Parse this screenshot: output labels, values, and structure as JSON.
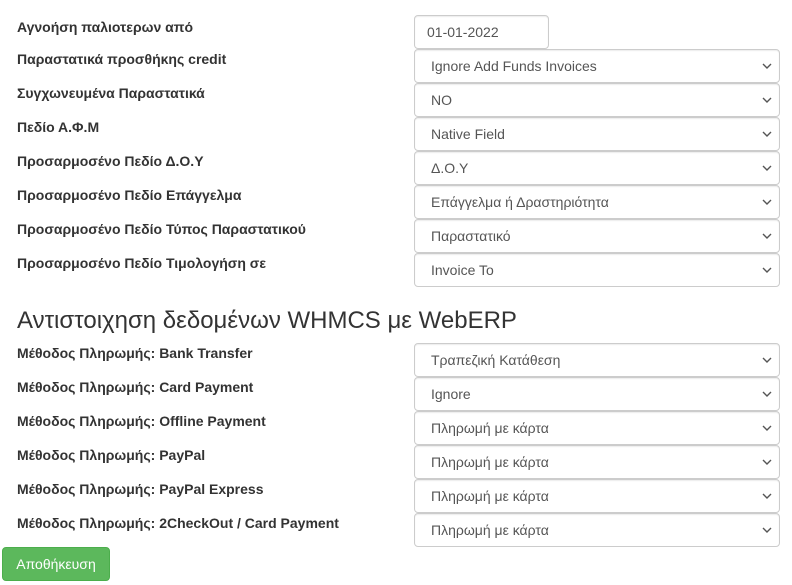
{
  "settings": [
    {
      "label": "Αγνοήση παλιοτερων από",
      "type": "date",
      "value": "01-01-2022"
    },
    {
      "label": "Παραστατικά προσθήκης credit",
      "type": "select",
      "value": "Ignore Add Funds Invoices"
    },
    {
      "label": "Συγχωνευμένα Παραστατικά",
      "type": "select",
      "value": "NO"
    },
    {
      "label": "Πεδίο Α.Φ.Μ",
      "type": "select",
      "value": "Native Field"
    },
    {
      "label": "Προσαρμοσένο Πεδίο Δ.Ο.Υ",
      "type": "select",
      "value": "Δ.Ο.Υ"
    },
    {
      "label": "Προσαρμοσένο Πεδίο Επάγγελμα",
      "type": "select",
      "value": "Επάγγελμα ή Δραστηριότητα"
    },
    {
      "label": "Προσαρμοσένο Πεδίο Τύπος Παραστατικού",
      "type": "select",
      "value": "Παραστατικό"
    },
    {
      "label": "Προσαρμοσένο Πεδίο Τιμολογήση σε",
      "type": "select",
      "value": "Invoice To"
    }
  ],
  "mapping_heading": "Αντιστοιχηση δεδομένων WHMCS με WebERP",
  "payment_methods": [
    {
      "label": "Μέθοδος Πληρωμής: Bank Transfer",
      "value": "Τραπεζική Κατάθεση"
    },
    {
      "label": "Μέθοδος Πληρωμής: Card Payment",
      "value": "Ignore"
    },
    {
      "label": "Μέθοδος Πληρωμής: Offline Payment",
      "value": "Πληρωμή με κάρτα"
    },
    {
      "label": "Μέθοδος Πληρωμής: PayPal",
      "value": "Πληρωμή με κάρτα"
    },
    {
      "label": "Μέθοδος Πληρωμής: PayPal Express",
      "value": "Πληρωμή με κάρτα"
    },
    {
      "label": "Μέθοδος Πληρωμής: 2CheckOut / Card Payment",
      "value": "Πληρωμή με κάρτα"
    }
  ],
  "save_button": "Αποθήκευση",
  "colors": {
    "save_button": "#5cb85c"
  }
}
